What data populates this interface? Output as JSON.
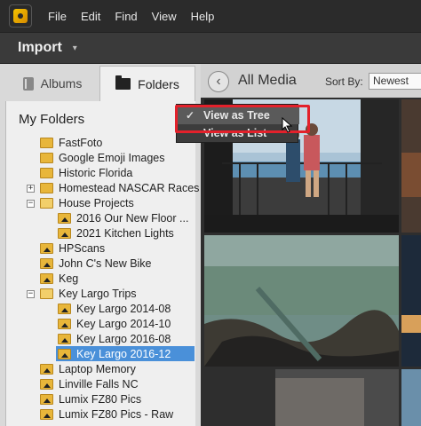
{
  "menu": {
    "items": [
      "File",
      "Edit",
      "Find",
      "View",
      "Help"
    ]
  },
  "import_bar": {
    "label": "Import",
    "caret": "▾"
  },
  "left_panel": {
    "tabs": {
      "albums": "Albums",
      "folders": "Folders"
    },
    "section_title": "My Folders",
    "tree": [
      {
        "label": "FastFoto",
        "expander": ""
      },
      {
        "label": "Google Emoji Images",
        "expander": ""
      },
      {
        "label": "Historic Florida",
        "expander": ""
      },
      {
        "label": "Homestead NASCAR Races",
        "expander": "+"
      },
      {
        "label": "House Projects",
        "expander": "−"
      },
      {
        "label": "2016 Our New Floor ...",
        "expander": ""
      },
      {
        "label": "2021 Kitchen Lights",
        "expander": ""
      },
      {
        "label": "HPScans",
        "expander": ""
      },
      {
        "label": "John C's New Bike",
        "expander": ""
      },
      {
        "label": "Keg",
        "expander": ""
      },
      {
        "label": "Key Largo Trips",
        "expander": "−"
      },
      {
        "label": "Key Largo 2014-08",
        "expander": ""
      },
      {
        "label": "Key Largo 2014-10",
        "expander": ""
      },
      {
        "label": "Key Largo 2016-08",
        "expander": ""
      },
      {
        "label": "Key Largo 2016-12",
        "expander": ""
      },
      {
        "label": "Laptop Memory",
        "expander": ""
      },
      {
        "label": "Linville Falls NC",
        "expander": ""
      },
      {
        "label": "Lumix FZ80 Pics",
        "expander": ""
      },
      {
        "label": "Lumix FZ80 Pics - Raw",
        "expander": ""
      }
    ]
  },
  "right_panel": {
    "back_icon": "‹",
    "title": "All Media",
    "sort_label": "Sort By:",
    "sort_value": "Newest"
  },
  "context_menu": {
    "items": [
      "View as Tree",
      "View as List"
    ],
    "check": "✓"
  },
  "colors": {
    "highlight_box": "#e3212b",
    "selection": "#4a90d9",
    "folder": "#e8b63a"
  }
}
